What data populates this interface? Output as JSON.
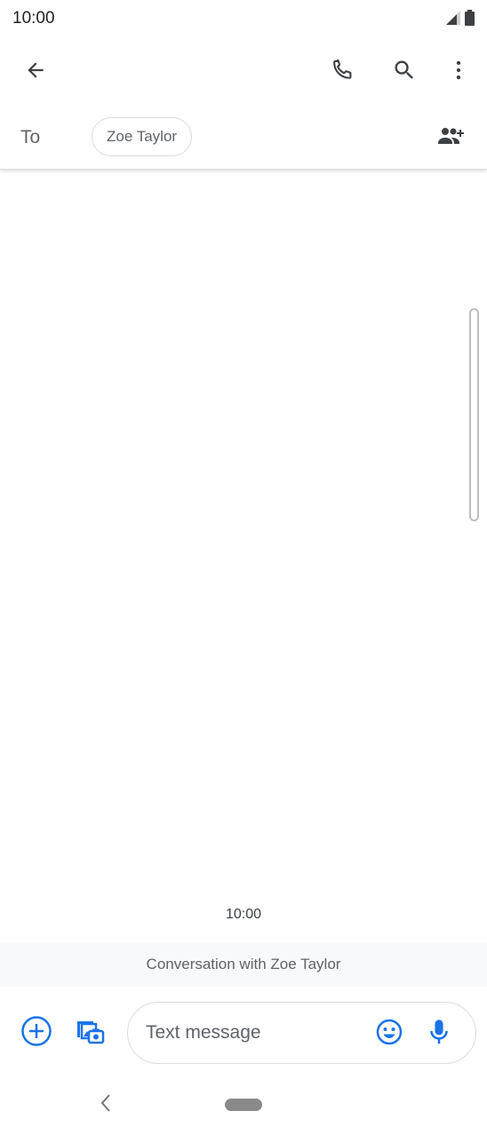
{
  "status_bar": {
    "time": "10:00",
    "icons": [
      "signal-icon",
      "battery-icon"
    ]
  },
  "app_bar": {
    "icons": [
      "back-arrow-icon",
      "phone-icon",
      "search-icon",
      "more-vert-icon"
    ]
  },
  "recipient": {
    "to_label": "To",
    "chip_name": "Zoe Taylor",
    "add_icon": "add-people-icon"
  },
  "conversation": {
    "timestamp": "10:00",
    "banner": "Conversation with Zoe Taylor"
  },
  "compose": {
    "placeholder": "Text message",
    "icons": [
      "add-circle-icon",
      "gallery-icon",
      "emoji-icon",
      "mic-icon"
    ]
  },
  "colors": {
    "accent": "#1a73e8",
    "icon_gray": "#3c4043"
  }
}
